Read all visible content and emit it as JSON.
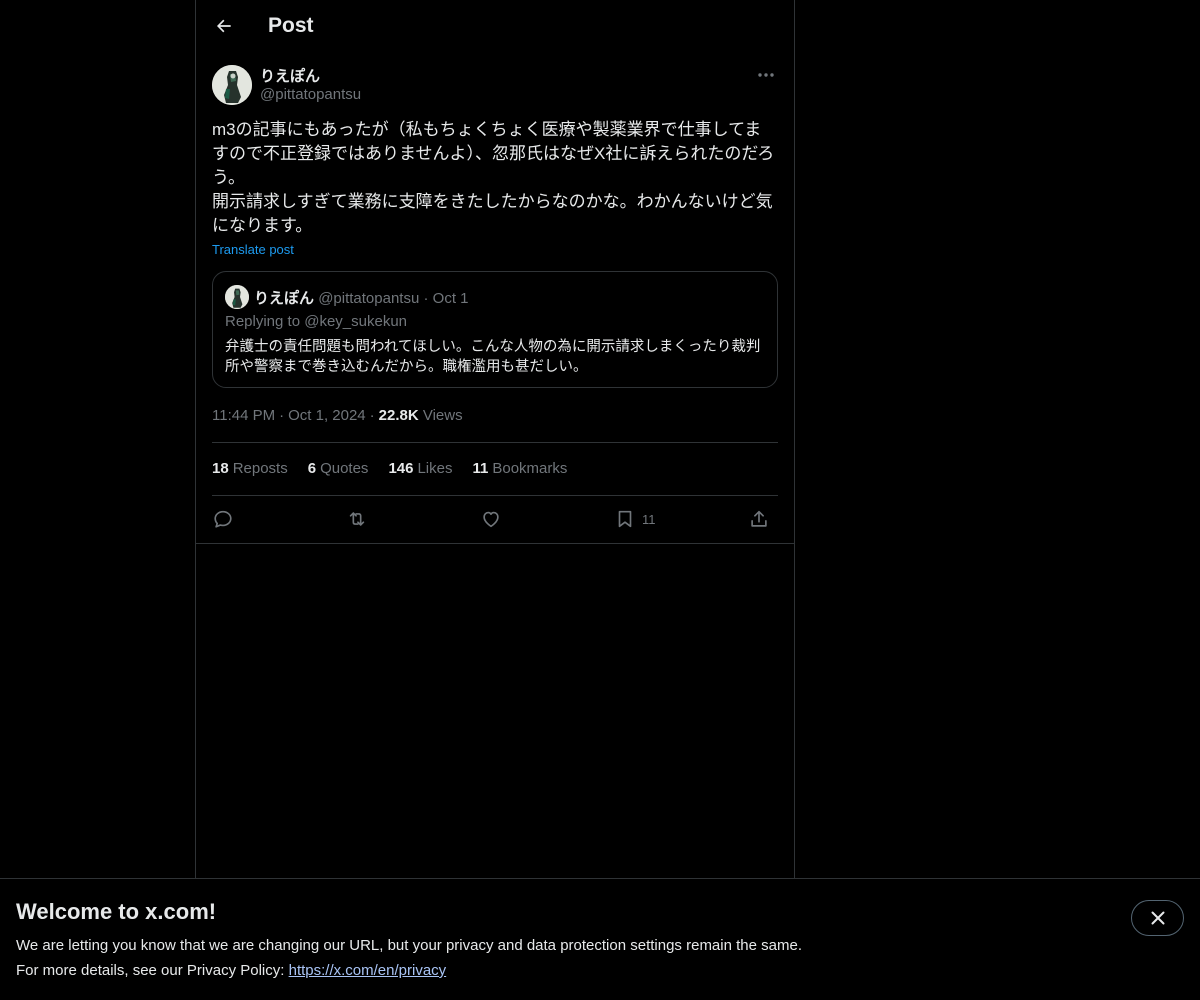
{
  "header": {
    "title": "Post",
    "back_icon": "arrow-left-icon"
  },
  "post": {
    "author_name": "りえぽん",
    "author_handle": "@pittatopantsu",
    "text": "m3の記事にもあったが（私もちょくちょく医療や製薬業界で仕事してますので不正登録ではありませんよ）、忽那氏はなぜX社に訴えられたのだろう。\n開示請求しすぎて業務に支障をきたしたからなのかな。わかんないけど気になります。",
    "translate_label": "Translate post",
    "time": "11:44 PM",
    "date": "Oct 1, 2024",
    "views_count": "22.8K",
    "views_label": "Views"
  },
  "quote": {
    "author_name": "りえぽん",
    "author_handle": "@pittatopantsu",
    "date": "Oct 1",
    "replying_label": "Replying to",
    "replying_to": "@key_sukekun",
    "text": "弁護士の責任問題も問われてほしい。こんな人物の為に開示請求しまくったり裁判所や警察まで巻き込むんだから。職権濫用も甚だしい。"
  },
  "stats": {
    "reposts_count": "18",
    "reposts_label": "Reposts",
    "quotes_count": "6",
    "quotes_label": "Quotes",
    "likes_count": "146",
    "likes_label": "Likes",
    "bookmarks_count": "11",
    "bookmarks_label": "Bookmarks"
  },
  "actions": {
    "reply_icon": "reply-icon",
    "repost_icon": "repost-icon",
    "like_icon": "heart-icon",
    "bookmark_icon": "bookmark-icon",
    "bookmark_count": "11",
    "share_icon": "share-icon"
  },
  "banner": {
    "title": "Welcome to x.com!",
    "line1": "We are letting you know that we are changing our URL, but your privacy and data protection settings remain the same.",
    "line2_prefix": "For more details, see our Privacy Policy:",
    "link_text": "https://x.com/en/privacy"
  },
  "colors": {
    "background": "#000000",
    "text": "#e7e9ea",
    "muted": "#71767b",
    "accent": "#1d9bf0",
    "border": "#2f3336"
  }
}
